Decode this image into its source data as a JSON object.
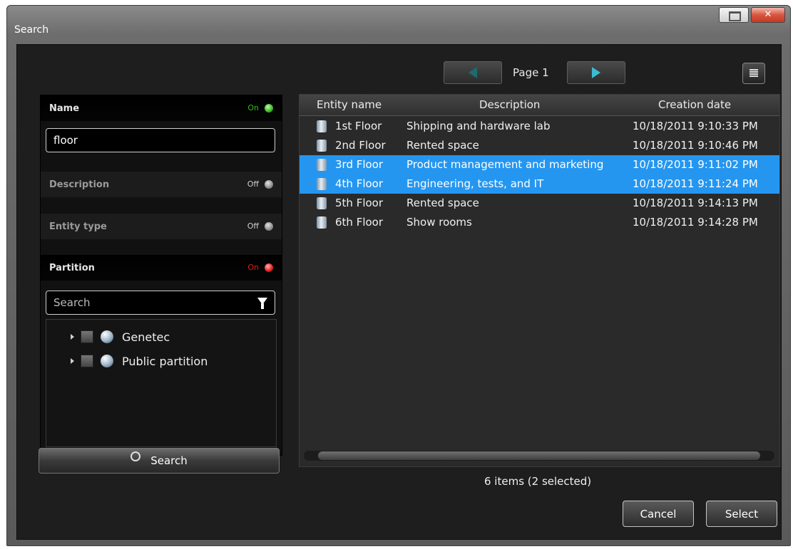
{
  "window": {
    "title": "Search",
    "close_glyph": "✕"
  },
  "pager": {
    "page_label": "Page 1",
    "prev_icon": "arrow-left-icon",
    "next_icon": "arrow-right-icon"
  },
  "filters": {
    "name": {
      "label": "Name",
      "state": "On",
      "value": "floor",
      "state_color": "#38b81f"
    },
    "description": {
      "label": "Description",
      "state": "Off"
    },
    "entity_type": {
      "label": "Entity type",
      "state": "Off"
    },
    "partition": {
      "label": "Partition",
      "state": "On",
      "state_color": "#e01d1d",
      "search_placeholder": "Search",
      "items": [
        {
          "label": "Genetec"
        },
        {
          "label": "Public partition"
        }
      ]
    }
  },
  "search_button": "Search",
  "table": {
    "columns": [
      "Entity name",
      "Description",
      "Creation date"
    ],
    "rows": [
      {
        "name": "1st Floor",
        "description": "Shipping and hardware lab",
        "date": "10/18/2011 9:10:33 PM",
        "selected": false
      },
      {
        "name": "2nd Floor",
        "description": "Rented space",
        "date": "10/18/2011 9:10:46 PM",
        "selected": false
      },
      {
        "name": "3rd Floor",
        "description": "Product management and marketing",
        "date": "10/18/2011 9:11:02 PM",
        "selected": true
      },
      {
        "name": "4th Floor",
        "description": "Engineering, tests, and IT",
        "date": "10/18/2011 9:11:24 PM",
        "selected": true
      },
      {
        "name": "5th Floor",
        "description": "Rented space",
        "date": "10/18/2011 9:14:13 PM",
        "selected": false
      },
      {
        "name": "6th Floor",
        "description": "Show rooms",
        "date": "10/18/2011 9:14:28 PM",
        "selected": false
      }
    ],
    "selection_color": "#2596f0"
  },
  "status": "6 items (2 selected)",
  "buttons": {
    "cancel": "Cancel",
    "select": "Select"
  }
}
